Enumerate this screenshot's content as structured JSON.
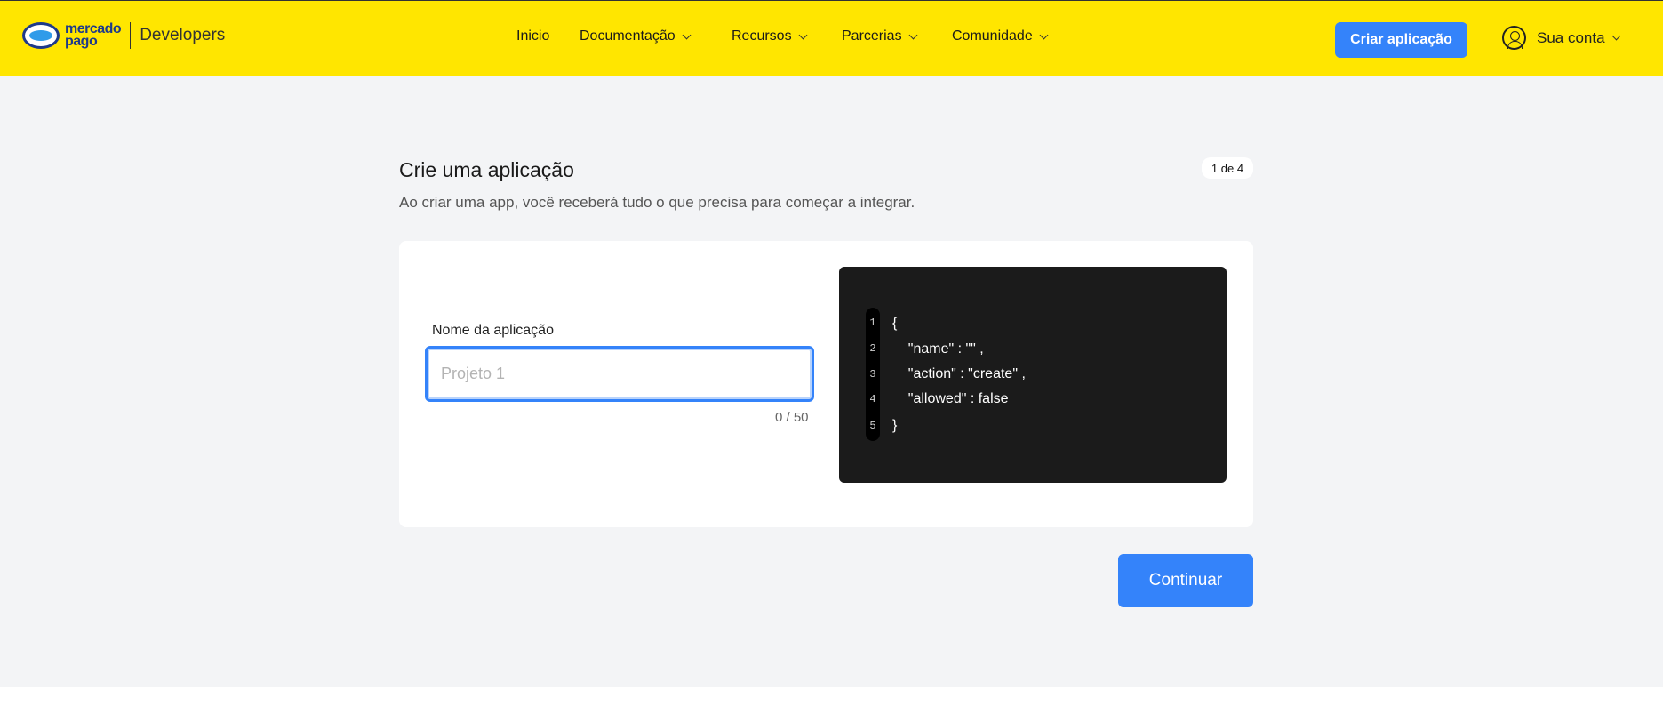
{
  "header": {
    "logo_line1": "mercado",
    "logo_line2": "pago",
    "logo_product": "Developers",
    "nav": [
      {
        "label": "Inicio"
      },
      {
        "label": "Documentação"
      },
      {
        "label": "Recursos"
      },
      {
        "label": "Parcerias"
      },
      {
        "label": "Comunidade"
      }
    ],
    "create_button": "Criar aplicação",
    "account_label": "Sua conta"
  },
  "page": {
    "title": "Crie uma aplicação",
    "step": "1 de 4",
    "subtitle": "Ao criar uma app, você receberá tudo o que precisa para começar a integrar."
  },
  "form": {
    "name_label": "Nome da aplicação",
    "name_value": "",
    "name_placeholder": "Projeto 1",
    "counter": "0 / 50"
  },
  "code": {
    "line_numbers": [
      "1",
      "2",
      "3",
      "4",
      "5"
    ],
    "lines": [
      "{",
      "    \"name\" : \"\" ,",
      "    \"action\" : \"create\" ,",
      "    \"allowed\" : false",
      "}"
    ]
  },
  "actions": {
    "continue_label": "Continuar"
  },
  "colors": {
    "header_bg": "#ffe600",
    "primary": "#3483fa",
    "page_bg": "#f3f4f6",
    "code_bg": "#1b1b1b"
  }
}
